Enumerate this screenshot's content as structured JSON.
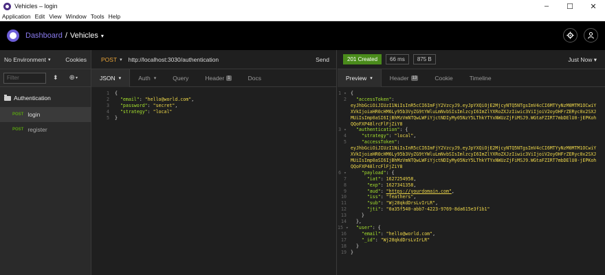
{
  "window": {
    "title": "Vehicles – login",
    "minimize": "–",
    "maximize": "☐",
    "close": "✕"
  },
  "menu": [
    "Application",
    "Edit",
    "View",
    "Window",
    "Tools",
    "Help"
  ],
  "header": {
    "dashboard": "Dashboard",
    "separator": "/",
    "project": "Vehicles",
    "caret": "▾"
  },
  "sidebar": {
    "environment": "No Environment",
    "cookies": "Cookies",
    "filter_placeholder": "Filter",
    "folder": "Authentication",
    "items": [
      {
        "method": "POST",
        "name": "login"
      },
      {
        "method": "POST",
        "name": "register"
      }
    ]
  },
  "request": {
    "method": "POST",
    "url": "http://localhost:3030/authentication",
    "send": "Send",
    "tabs": {
      "body": "JSON",
      "auth": "Auth",
      "query": "Query",
      "header": "Header",
      "header_count": "1",
      "docs": "Docs"
    },
    "lines": [
      {
        "n": "1",
        "t": "{"
      },
      {
        "n": "2",
        "k": "\"email\"",
        "v": "\"hello@world.com\"",
        "end": ","
      },
      {
        "n": "3",
        "k": "\"password\"",
        "v": "\"secret\"",
        "end": ","
      },
      {
        "n": "4",
        "k": "\"strategy\"",
        "v": "\"local\"",
        "end": ""
      },
      {
        "n": "5",
        "t": "}"
      }
    ]
  },
  "response": {
    "status": "201 Created",
    "time": "66 ms",
    "size": "875 B",
    "history": "Just Now",
    "tabs": {
      "preview": "Preview",
      "header": "Header",
      "header_count": "13",
      "cookie": "Cookie",
      "timeline": "Timeline"
    },
    "token1": "eyJhbGciOiJIUzI1NiIsInR5cCI6ImFjY2VzcyJ9.eyJpYXQiOjE2MjcyNTQ5NTgsImV4cCI6MTYyNzM0MTM1OCwiYXVkIjoiaHR0cHM6Ly95b3VyZG9tYWluLmNvbSIsImlzcyI6ImZlYXRoZXJzIiwic3ViIjoiV2oyOHFrZERyc0x2SXJMUiIsImp0aSI6IjBhMzVmNTQwLWFiYjctNDIyMy05NzY5LThkYTYxNWUzZjFiMSJ9.WGtaFZIRT7mbDElU0-jEPKohQQoFXP48lrcFlFjZiY8",
    "token2": "eyJhbGciOiJIUzI1NiIsInR5cCI6ImFjY2VzcyJ9.eyJpYXQiOjE2MjcyNTQ5NTgsImV4cCI6MTYyNzM0MTM1OCwiYXVkIjoiaHR0cHM6Ly95b3VyZG9tYWluLmNvbSIsImlzcyI6ImZlYXRoZXJzIiwic3ViIjoiV2oyOHFrZERyc0x2SXJMUiIsImp0aSI6IjBhMzVmNTQwLWFiYjctNDIyMy05NzY5LThkYTYxNWUzZjFiMSJ9.WGtaFZIRT7mbDElU0-jEPKohQQoFXP48lrcFlFjZiY8",
    "iat": "1627254958",
    "exp": "1627341358",
    "aud": "\"https://yourdomain.com\"",
    "iss": "\"feathers\"",
    "sub": "\"Wj28qkdDrsLvIrLR\"",
    "jti": "\"0a35f540-abb7-4223-9769-8da615e3f1b1\"",
    "email": "\"hello@world.com\"",
    "id": "\"Wj28qkdDrsLvIrLR\""
  }
}
